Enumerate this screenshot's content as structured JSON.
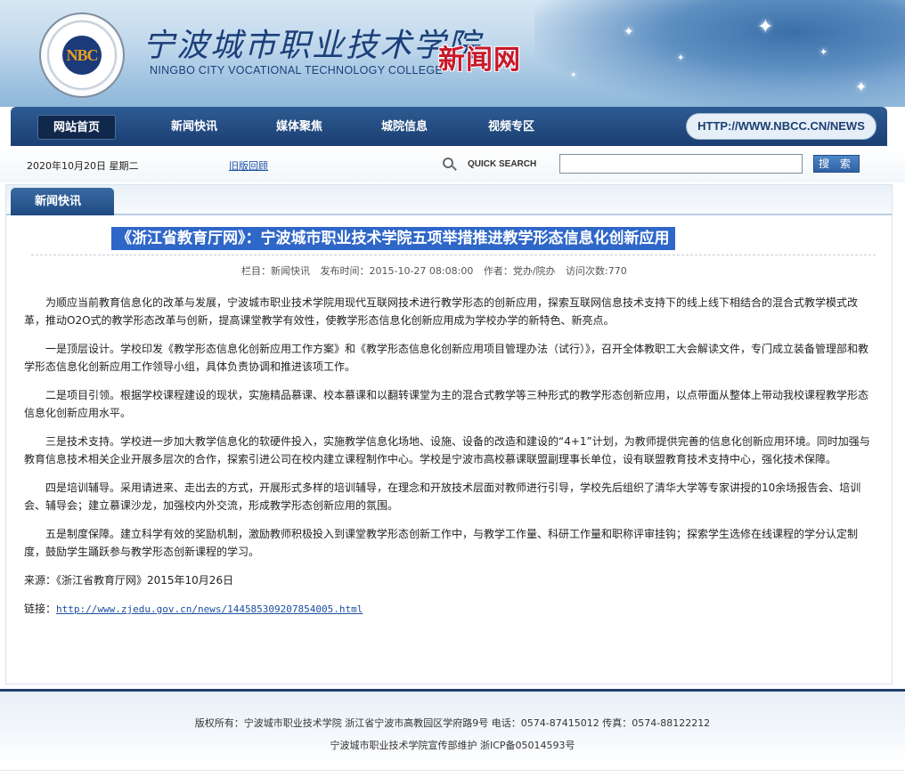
{
  "header": {
    "title_cn": "宁波城市职业技术学院",
    "title_en": "NINGBO CITY VOCATIONAL TECHNOLOGY COLLEGE",
    "site_name": "新闻网",
    "logo_text": "NBC"
  },
  "nav": {
    "items": [
      {
        "label": "网站首页",
        "active": true
      },
      {
        "label": "新闻快讯"
      },
      {
        "label": "媒体聚焦"
      },
      {
        "label": "城院信息"
      },
      {
        "label": "视频专区"
      }
    ],
    "url": "HTTP://WWW.NBCC.CN/NEWS"
  },
  "toolbar": {
    "date": "2020年10月20日 星期二",
    "old_link": "旧版回顾",
    "quick_search": "QUICK SEARCH",
    "search_value": "",
    "search_button": "搜 索"
  },
  "section": {
    "tab": "新闻快讯"
  },
  "article": {
    "title": "《浙江省教育厅网》：宁波城市职业技术学院五项举措推进教学形态信息化创新应用",
    "meta": {
      "column": "栏目：新闻快讯",
      "time": "发布时间：2015-10-27 08:08:00",
      "author": "作者：党办/院办",
      "views": "访问次数:770"
    },
    "paragraphs": [
      "为顺应当前教育信息化的改革与发展，宁波城市职业技术学院用现代互联网技术进行教学形态的创新应用，探索互联网信息技术支持下的线上线下相结合的混合式教学模式改革，推动O2O式的教学形态改革与创新，提高课堂教学有效性，使教学形态信息化创新应用成为学校办学的新特色、新亮点。",
      "一是顶层设计。学校印发《教学形态信息化创新应用工作方案》和《教学形态信息化创新应用项目管理办法（试行）》，召开全体教职工大会解读文件，专门成立装备管理部和教学形态信息化创新应用工作领导小组，具体负责协调和推进该项工作。",
      "二是项目引领。根据学校课程建设的现状，实施精品慕课、校本慕课和以翻转课堂为主的混合式教学等三种形式的教学形态创新应用，以点带面从整体上带动我校课程教学形态信息化创新应用水平。",
      "三是技术支持。学校进一步加大教学信息化的软硬件投入，实施教学信息化场地、设施、设备的改造和建设的“4+1”计划，为教师提供完善的信息化创新应用环境。同时加强与教育信息技术相关企业开展多层次的合作，探索引进公司在校内建立课程制作中心。学校是宁波市高校慕课联盟副理事长单位，设有联盟教育技术支持中心，强化技术保障。",
      "四是培训辅导。采用请进来、走出去的方式，开展形式多样的培训辅导，在理念和开放技术层面对教师进行引导，学校先后组织了清华大学等专家讲授的10余场报告会、培训会、辅导会；建立慕课沙龙，加强校内外交流，形成教学形态创新应用的氛围。",
      "五是制度保障。建立科学有效的奖励机制，激励教师积极投入到课堂教学形态创新工作中，与教学工作量、科研工作量和职称评审挂钩；探索学生选修在线课程的学分认定制度，鼓励学生踊跃参与教学形态创新课程的学习。"
    ],
    "source": "来源：《浙江省教育厅网》2015年10月26日",
    "link_label": "链接：",
    "link_url": "http://www.zjedu.gov.cn/news/144585309207854005.html"
  },
  "footer": {
    "line1": "版权所有：宁波城市职业技术学院  浙江省宁波市高教园区学府路9号  电话：0574-87415012  传真：0574-88122212",
    "line2": "宁波城市职业技术学院宣传部维护  浙ICP备05014593号"
  }
}
